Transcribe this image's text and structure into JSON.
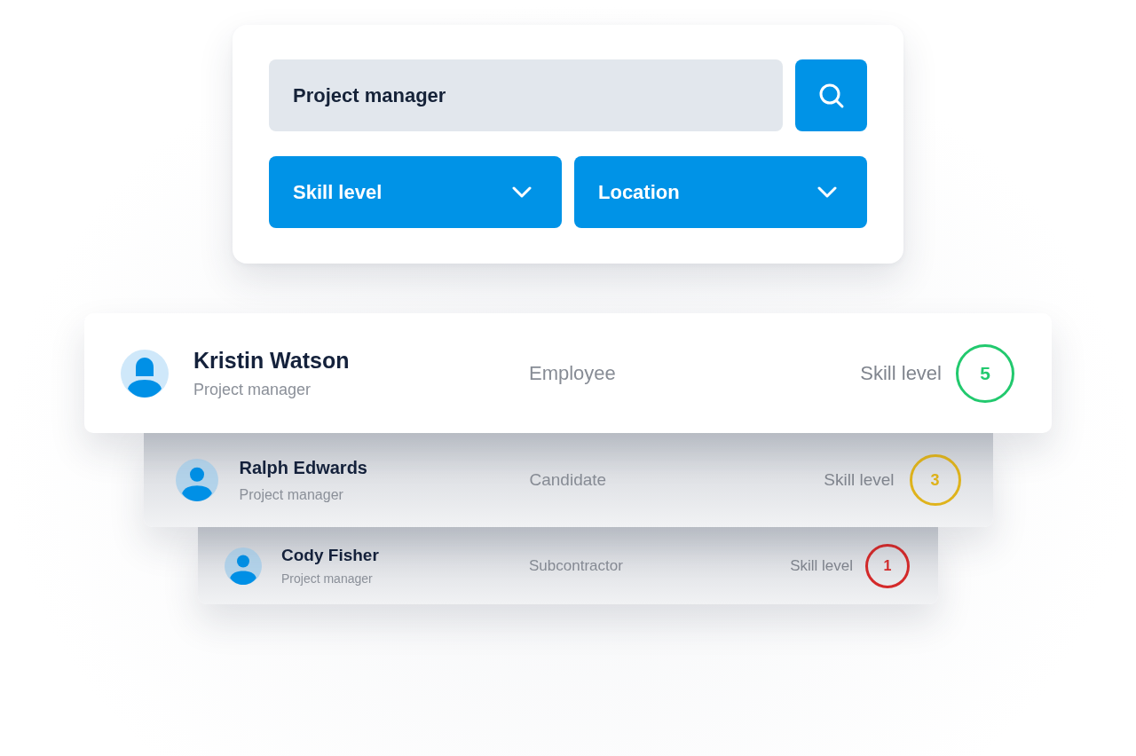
{
  "search": {
    "value": "Project manager"
  },
  "filters": [
    {
      "label": "Skill level"
    },
    {
      "label": "Location"
    }
  ],
  "people": [
    {
      "name": "Kristin Watson",
      "role": "Project manager",
      "type": "Employee",
      "skill_label": "Skill level",
      "skill": "5",
      "color": "#22c96e"
    },
    {
      "name": "Ralph Edwards",
      "role": "Project manager",
      "type": "Candidate",
      "skill_label": "Skill level",
      "skill": "3",
      "color": "#dfb31c"
    },
    {
      "name": "Cody Fisher",
      "role": "Project manager",
      "type": "Subcontractor",
      "skill_label": "Skill level",
      "skill": "1",
      "color": "#d42a2a"
    }
  ]
}
